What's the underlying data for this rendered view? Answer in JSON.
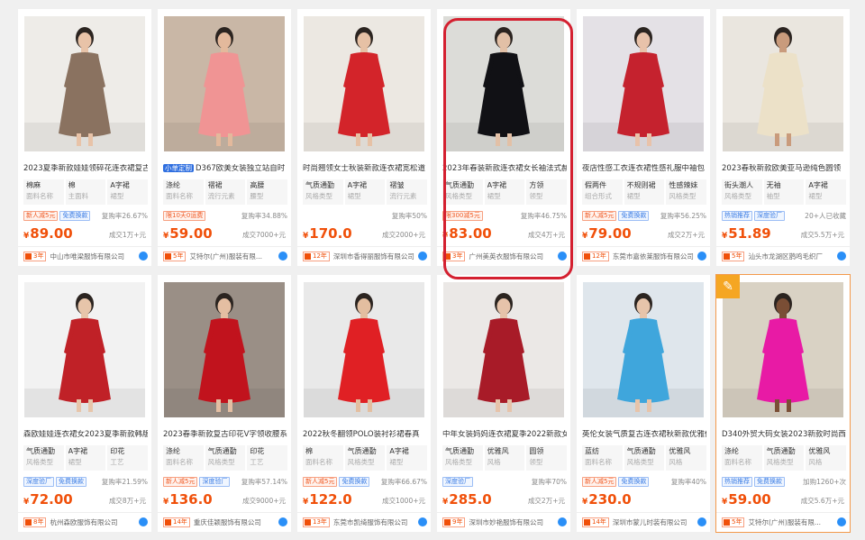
{
  "products": [
    {
      "title": "2023夏季新款娃娃领碎花连衣裙复古",
      "title_tag": "",
      "attrs": [
        [
          "棉麻",
          "面料名称"
        ],
        [
          "棉",
          "主面料"
        ],
        [
          "A字裙",
          "裙型"
        ]
      ],
      "badges": [
        [
          "新人减5元",
          "red"
        ],
        [
          "免费换款",
          "blue"
        ]
      ],
      "stat": "复购率26.67%",
      "price": "89.00",
      "sold": "成交1万+元",
      "years": "3年",
      "shop": "中山市唯梁服饰有限公司",
      "img_bg": "#eeece8",
      "dress": "#8a7260",
      "skin": "#e8c3a8"
    },
    {
      "title": "D367欧美女装独立站自时",
      "title_tag": "小单定制",
      "attrs": [
        [
          "涤纶",
          "面料名称"
        ],
        [
          "褶裙",
          "流行元素"
        ],
        [
          "高腰",
          "腰型"
        ]
      ],
      "badges": [
        [
          "限10天0运费",
          "red"
        ]
      ],
      "stat": "复购率34.88%",
      "price": "59.00",
      "sold": "成交7000+元",
      "years": "5年",
      "shop": "艾特尔(广州)服装有限...",
      "img_bg": "#c9b7a6",
      "dress": "#f09494",
      "skin": "#e3b99c"
    },
    {
      "title": "时尚翘领女士秋装新款连衣裙宽松道",
      "title_tag": "",
      "attrs": [
        [
          "气质通勤",
          "风格类型"
        ],
        [
          "A字裙",
          "裙型"
        ],
        [
          "褶皱",
          "流行元素"
        ]
      ],
      "badges": [],
      "stat": "复购率50%",
      "price": "170.0",
      "sold": "成交2000+元",
      "years": "12年",
      "shop": "深圳市香得丽服饰有限公司",
      "img_bg": "#ece8e2",
      "dress": "#d3242a",
      "skin": "#e6c1a5"
    },
    {
      "title": "2023年春装新款连衣裙女长袖法式赫",
      "title_tag": "",
      "attrs": [
        [
          "气质通勤",
          "风格类型"
        ],
        [
          "A字裙",
          "裙型"
        ],
        [
          "方领",
          "领型"
        ]
      ],
      "badges": [
        [
          "限300减5元",
          "red"
        ]
      ],
      "stat": "复购率46.75%",
      "price": "83.00",
      "sold": "成交4万+元",
      "years": "3年",
      "shop": "广州美英衣服饰有限公司",
      "img_bg": "#dcdcd8",
      "dress": "#111115",
      "skin": "#e2c0a6"
    },
    {
      "title": "夜店性感工衣连衣裙性感礼服中袖包",
      "title_tag": "",
      "attrs": [
        [
          "假两件",
          "组合形式"
        ],
        [
          "不规则裙",
          "裙型"
        ],
        [
          "性感辣妹",
          "风格类型"
        ]
      ],
      "badges": [
        [
          "新人减5元",
          "red"
        ],
        [
          "免费换款",
          "blue"
        ]
      ],
      "stat": "复购率56.25%",
      "price": "79.00",
      "sold": "成交2万+元",
      "years": "12年",
      "shop": "东莞市嘉依莱服饰有限公司",
      "img_bg": "#e4e1e6",
      "dress": "#c5222e",
      "skin": "#e8c2aa"
    },
    {
      "title": "2023春秋新款欧美亚马逊纯色圆领",
      "title_tag": "",
      "attrs": [
        [
          "街头潮人",
          "风格类型"
        ],
        [
          "无袖",
          "袖型"
        ],
        [
          "A字裙",
          "裙型"
        ]
      ],
      "badges": [
        [
          "热销推荐",
          "blue"
        ],
        [
          "深度验厂",
          "blue"
        ]
      ],
      "stat": "20+人已收藏",
      "price": "51.89",
      "sold": "成交5.5万+元",
      "years": "5年",
      "shop": "汕头市龙湖区鹊鸣毛织厂",
      "img_bg": "#eae6df",
      "dress": "#ece1c8",
      "skin": "#c99b7c"
    },
    {
      "title": "森欧娃娃连衣裙女2023夏季新款韩版",
      "title_tag": "",
      "attrs": [
        [
          "气质通勤",
          "风格类型"
        ],
        [
          "A字裙",
          "裙型"
        ],
        [
          "印花",
          "工艺"
        ]
      ],
      "badges": [
        [
          "深度验厂",
          "blue"
        ],
        [
          "免费换款",
          "blue"
        ]
      ],
      "stat": "复购率21.59%",
      "price": "72.00",
      "sold": "成交8万+元",
      "years": "8年",
      "shop": "杭州森欧服饰有限公司",
      "img_bg": "#f2f2f2",
      "dress": "#c02127",
      "skin": "#e7c5aa"
    },
    {
      "title": "2023春季新款复古印花V字领收腰系",
      "title_tag": "",
      "attrs": [
        [
          "涤纶",
          "面料名称"
        ],
        [
          "气质通勤",
          "风格类型"
        ],
        [
          "印花",
          "工艺"
        ]
      ],
      "badges": [
        [
          "新人减5元",
          "red"
        ],
        [
          "深度验厂",
          "blue"
        ]
      ],
      "stat": "复购率57.14%",
      "price": "136.0",
      "sold": "成交9000+元",
      "years": "14年",
      "shop": "重庆佳颖服饰有限公司",
      "img_bg": "#9a8f86",
      "dress": "#c1131d",
      "skin": "#e4bea2"
    },
    {
      "title": "2022秋冬翻领POLO装衬衫裙春真",
      "title_tag": "",
      "attrs": [
        [
          "棉",
          "面料名称"
        ],
        [
          "气质通勤",
          "风格类型"
        ],
        [
          "A字裙",
          "裙型"
        ]
      ],
      "badges": [
        [
          "新人减5元",
          "red"
        ],
        [
          "免费换款",
          "blue"
        ]
      ],
      "stat": "复购率66.67%",
      "price": "122.0",
      "sold": "成交1000+元",
      "years": "13年",
      "shop": "东莞市凯绮服饰有限公司",
      "img_bg": "#e9e9e9",
      "dress": "#e02024",
      "skin": "#e3bea0"
    },
    {
      "title": "中年女装妈妈连衣裙夏季2022新款女",
      "title_tag": "",
      "attrs": [
        [
          "气质通勤",
          "风格类型"
        ],
        [
          "优雅风",
          "风格"
        ],
        [
          "圆领",
          "领型"
        ]
      ],
      "badges": [
        [
          "深度验厂",
          "blue"
        ]
      ],
      "stat": "复购率70%",
      "price": "285.0",
      "sold": "成交2万+元",
      "years": "9年",
      "shop": "深圳市妙艳服饰有限公司",
      "img_bg": "#ebe8e6",
      "dress": "#a81b28",
      "skin": "#e6c3aa"
    },
    {
      "title": "英伦女装气质复古连衣裙秋新款优雅仙气",
      "title_tag": "",
      "attrs": [
        [
          "蓝纺",
          "面料名称"
        ],
        [
          "气质通勤",
          "风格类型"
        ],
        [
          "优雅风",
          "风格"
        ]
      ],
      "badges": [
        [
          "新人减5元",
          "red"
        ],
        [
          "免费换款",
          "blue"
        ]
      ],
      "stat": "复购率40%",
      "price": "230.0",
      "sold": "",
      "years": "14年",
      "shop": "深圳市蒙儿时装有限公司",
      "img_bg": "#dfe6ec",
      "dress": "#3fa6dc",
      "skin": "#e7c4aa"
    },
    {
      "title": "D340外贸大码女装2023新款时尚西...",
      "title_tag": "",
      "attrs": [
        [
          "涤纶",
          "面料名称"
        ],
        [
          "气质通勤",
          "风格类型"
        ],
        [
          "优雅风",
          "风格"
        ]
      ],
      "badges": [
        [
          "热销推荐",
          "blue"
        ],
        [
          "免费换款",
          "blue"
        ]
      ],
      "stat": "加购1260+次",
      "price": "59.00",
      "sold": "成交5.6万+元",
      "years": "5年",
      "shop": "艾特尔(广州)服装有限...",
      "img_bg": "#d9d2c4",
      "dress": "#e81aa5",
      "skin": "#7a4e35"
    }
  ],
  "currency": "¥",
  "highlighted_index": 11
}
